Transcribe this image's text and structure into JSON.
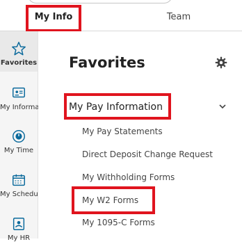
{
  "tabs": {
    "my_info": "My Info",
    "team": "Team"
  },
  "sidebar": {
    "items": [
      {
        "label": "Favorites",
        "icon": "star-icon"
      },
      {
        "label": "My Information",
        "icon": "id-card-icon"
      },
      {
        "label": "My Time",
        "icon": "clock-icon"
      },
      {
        "label": "My Schedule",
        "icon": "calendar-icon"
      },
      {
        "label": "My HR",
        "icon": "hr-icon"
      }
    ]
  },
  "content": {
    "title": "Favorites",
    "settings_icon": "gear-icon",
    "group": {
      "title": "My Pay Information",
      "links": [
        "My Pay Statements",
        "Direct Deposit Change Request",
        "My Withholding Forms",
        "My W2 Forms",
        "My 1095-C Forms"
      ]
    }
  },
  "colors": {
    "accent": "#0b6a9c",
    "highlight": "#e0141e"
  }
}
